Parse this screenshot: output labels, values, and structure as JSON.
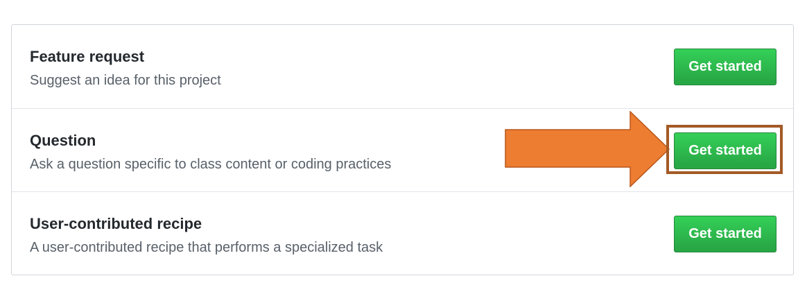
{
  "templates": [
    {
      "title": "Feature request",
      "description": "Suggest an idea for this project",
      "button_label": "Get started"
    },
    {
      "title": "Question",
      "description": "Ask a question specific to class content or coding practices",
      "button_label": "Get started"
    },
    {
      "title": "User-contributed recipe",
      "description": "A user-contributed recipe that performs a specialized task",
      "button_label": "Get started"
    }
  ],
  "colors": {
    "button_green": "#2cbe4e",
    "annotation_arrow": "#ed7d31",
    "annotation_box": "#a35a26"
  },
  "annotations": {
    "arrow_icon": "right-arrow-icon",
    "highlighted_row": 1
  }
}
